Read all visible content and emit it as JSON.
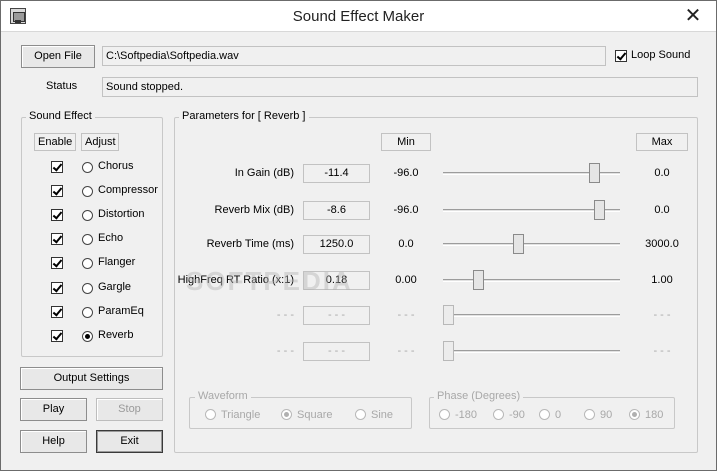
{
  "window": {
    "title": "Sound Effect Maker",
    "close_glyph": "✕"
  },
  "file": {
    "open_label": "Open File",
    "path": "C:\\Softpedia\\Softpedia.wav",
    "loop_label": "Loop Sound",
    "loop_checked": true
  },
  "status": {
    "label": "Status",
    "value": "Sound stopped."
  },
  "effects": {
    "group_label": "Sound Effect",
    "enable_header": "Enable",
    "adjust_header": "Adjust",
    "items": [
      {
        "name": "Chorus",
        "enabled": true,
        "adjust": false
      },
      {
        "name": "Compressor",
        "enabled": true,
        "adjust": false
      },
      {
        "name": "Distortion",
        "enabled": true,
        "adjust": false
      },
      {
        "name": "Echo",
        "enabled": true,
        "adjust": false
      },
      {
        "name": "Flanger",
        "enabled": true,
        "adjust": false
      },
      {
        "name": "Gargle",
        "enabled": true,
        "adjust": false
      },
      {
        "name": "ParamEq",
        "enabled": true,
        "adjust": false
      },
      {
        "name": "Reverb",
        "enabled": true,
        "adjust": true
      }
    ]
  },
  "buttons": {
    "output_settings": "Output Settings",
    "play": "Play",
    "stop": "Stop",
    "help": "Help",
    "exit": "Exit"
  },
  "params": {
    "group_label": "Parameters for [ Reverb ]",
    "min_header": "Min",
    "max_header": "Max",
    "rows": [
      {
        "label": "In Gain (dB)",
        "value": "-11.4",
        "min": "-96.0",
        "max": "0.0",
        "level": 0.88
      },
      {
        "label": "Reverb Mix (dB)",
        "value": "-8.6",
        "min": "-96.0",
        "max": "0.0",
        "level": 0.91
      },
      {
        "label": "Reverb Time (ms)",
        "value": "1250.0",
        "min": "0.0",
        "max": "3000.0",
        "level": 0.42
      },
      {
        "label": "HighFreq RT Ratio (x:1)",
        "value": "0.18",
        "min": "0.00",
        "max": "1.00",
        "level": 0.18
      },
      {
        "label": "- - -",
        "value": "- - -",
        "min": "- - -",
        "max": "- - -",
        "level": 0
      },
      {
        "label": "- - -",
        "value": "- - -",
        "min": "- - -",
        "max": "- - -",
        "level": 0
      }
    ]
  },
  "waveform": {
    "group_label": "Waveform",
    "options": [
      "Triangle",
      "Square",
      "Sine"
    ],
    "selected": "Square"
  },
  "phase": {
    "group_label": "Phase (Degrees)",
    "options": [
      "-180",
      "-90",
      "0",
      "90",
      "180"
    ],
    "selected": "180"
  },
  "watermark": "SOFTPEDIA",
  "colors": {
    "window_bg": "#f0f0f0",
    "title_bg": "#ffffff",
    "disabled_text": "#a8a8a8"
  }
}
